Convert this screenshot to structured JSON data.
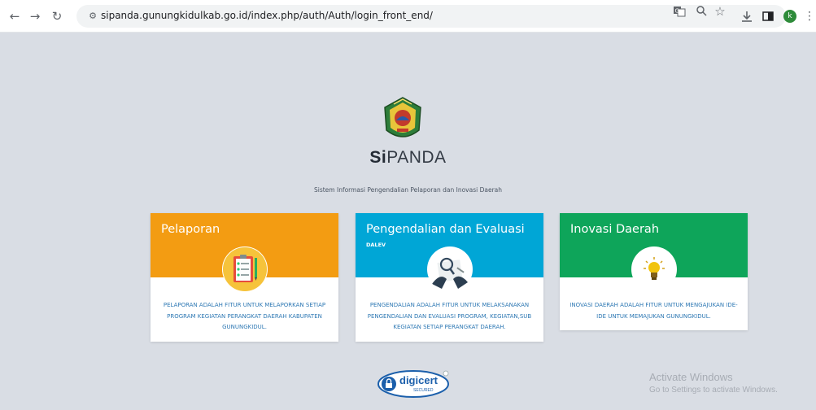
{
  "browser": {
    "url": "sipanda.gunungkidulkab.go.id/index.php/auth/Auth/login_front_end/",
    "profile_initial": "k",
    "icons": [
      "back-icon",
      "forward-icon",
      "reload-icon",
      "site-info-icon",
      "translate-icon",
      "zoom-icon",
      "star-icon",
      "download-icon",
      "sidepanel-icon",
      "profile-avatar",
      "menu-icon"
    ]
  },
  "brand": {
    "bold": "Si",
    "rest": "PANDA"
  },
  "subtitle": "Sistem Informasi Pengendalian Pelaporan dan Inovasi Daerah",
  "cards": [
    {
      "title": "Pelaporan",
      "subtitle": "",
      "color": "#f39c12",
      "icon": "clipboard-checklist-icon",
      "description": "PELAPORAN ADALAH FITUR UNTUK MELAPORKAN SETIAP PROGRAM KEGIATAN PERANGKAT DAERAH KABUPATEN GUNUNGKIDUL."
    },
    {
      "title": "Pengendalian dan Evaluasi",
      "subtitle": "DALEV",
      "color": "#00a6d6",
      "icon": "magnifier-document-icon",
      "description": "PENGENDALIAN ADALAH FITUR UNTUK MELAKSANAKAN PENGENDALIAN DAN EVALUASI PROGRAM, KEGIATAN,SUB KEGIATAN SETIAP PERANGKAT DAERAH."
    },
    {
      "title": "Inovasi Daerah",
      "subtitle": "",
      "color": "#0ea55a",
      "icon": "lightbulb-idea-icon",
      "description": "INOVASI DAERAH ADALAH FITUR UNTUK MENGAJUKAN IDE-IDE UNTUK MEMAJUKAN GUNUNGKIDUL."
    }
  ],
  "seal": {
    "name": "digicert",
    "label": "SECURED"
  },
  "watermark": {
    "line1": "Activate Windows",
    "line2": "Go to Settings to activate Windows."
  }
}
